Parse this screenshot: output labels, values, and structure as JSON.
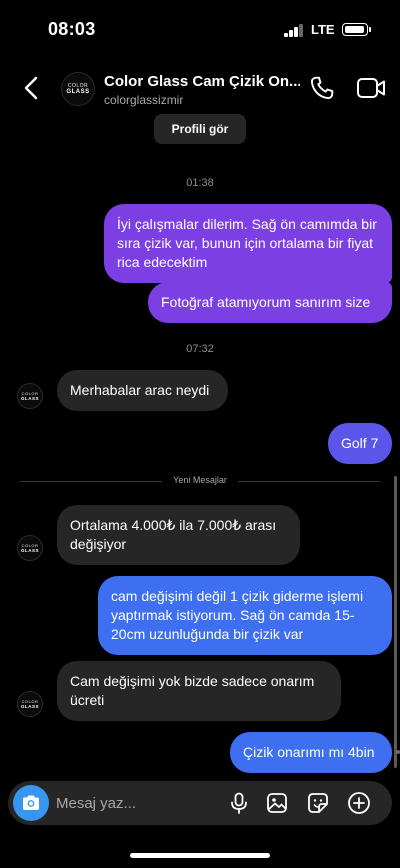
{
  "status_bar": {
    "time": "08:03",
    "network": "LTE"
  },
  "header": {
    "contact_name": "Color Glass Cam Çizik On...",
    "username": "colorglassizmir",
    "avatar_text_line1": "COLOR",
    "avatar_text_line2": "GLASS"
  },
  "chat": {
    "profile_button": "Profili gör",
    "timestamps": [
      "01:38",
      "07:32"
    ],
    "new_messages_label": "Yeni Mesajlar",
    "messages": [
      {
        "from": "me",
        "text": "İyi çalışmalar dilerim. Sağ ön camımda bir sıra çizik var, bunun için ortalama bir fiyat rica edecektim"
      },
      {
        "from": "me",
        "text": "Fotoğraf atamıyorum sanırım size"
      },
      {
        "from": "them",
        "text": "Merhabalar arac neydi"
      },
      {
        "from": "me",
        "text": "Golf 7"
      },
      {
        "from": "them",
        "text": "Ortalama 4.000₺ ila 7.000₺ arası değişiyor"
      },
      {
        "from": "me",
        "text": "cam değişimi değil 1 çizik giderme işlemi yaptırmak istiyorum. Sağ ön camda 15-20cm uzunluğunda bir çizik var"
      },
      {
        "from": "them",
        "text": "Cam değişimi yok bizde sadece onarım ücreti"
      },
      {
        "from": "me",
        "text": "Çizik onarımı mı 4bin"
      }
    ]
  },
  "composer": {
    "placeholder": "Mesaj yaz..."
  },
  "icons": [
    "back-icon",
    "call-icon",
    "video-icon",
    "camera-icon",
    "microphone-icon",
    "gallery-icon",
    "sticker-icon",
    "plus-icon"
  ],
  "colors": {
    "bubble_purple": "#7b3fe4",
    "bubble_violet": "#5b56ea",
    "bubble_blue": "#3d6ff0",
    "bubble_incoming": "#262626",
    "camera_button": "#3797f0"
  }
}
